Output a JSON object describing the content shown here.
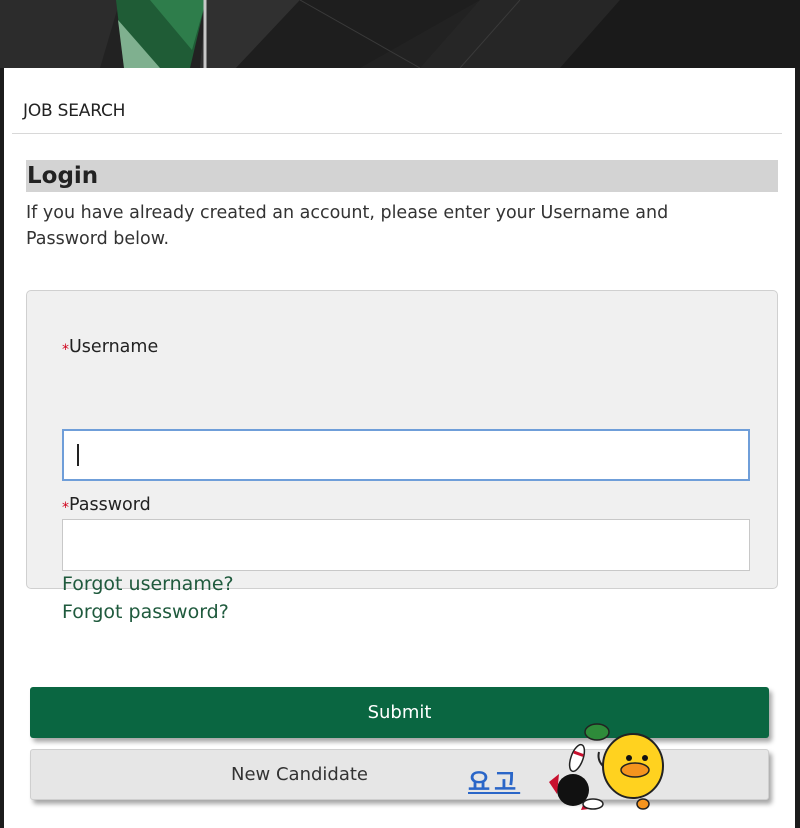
{
  "nav": {
    "label": "JOB SEARCH"
  },
  "login": {
    "heading": "Login",
    "intro": "If you have already created an account, please enter your Username and Password below."
  },
  "form": {
    "required_marker": "*",
    "username_label": "Username",
    "username_value": "",
    "password_label": "Password",
    "password_value": "",
    "forgot_username": "Forgot username?",
    "forgot_password": "Forgot password?"
  },
  "actions": {
    "submit_label": "Submit",
    "new_candidate_label": "New Candidate"
  },
  "overlay": {
    "korean_text": "요고",
    "sticker_icon": "duck-bowling-sticker-icon"
  },
  "colors": {
    "primary": "#0a6641",
    "link": "#1f5a3d",
    "required": "#d0021b",
    "heading_bg": "#d3d3d3",
    "focus": "#6f9ed9"
  }
}
